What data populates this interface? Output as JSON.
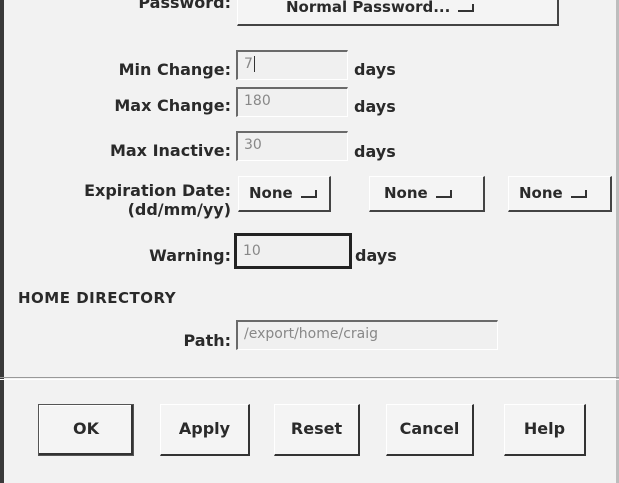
{
  "password": {
    "label": "Password:",
    "menu_value": "Normal Password..."
  },
  "min_change": {
    "label": "Min Change:",
    "value": "7",
    "unit": "days"
  },
  "max_change": {
    "label": "Max Change:",
    "value": "180",
    "unit": "days"
  },
  "max_inactive": {
    "label": "Max Inactive:",
    "value": "30",
    "unit": "days"
  },
  "expiration": {
    "label_line1": "Expiration Date:",
    "label_line2": "(dd/mm/yy)",
    "day": "None",
    "month": "None",
    "year": "None"
  },
  "warning": {
    "label": "Warning:",
    "value": "10",
    "unit": "days"
  },
  "home_directory": {
    "heading": "HOME DIRECTORY",
    "path_label": "Path:",
    "path_value": "/export/home/craig"
  },
  "buttons": {
    "ok": "OK",
    "apply": "Apply",
    "reset": "Reset",
    "cancel": "Cancel",
    "help": "Help"
  }
}
